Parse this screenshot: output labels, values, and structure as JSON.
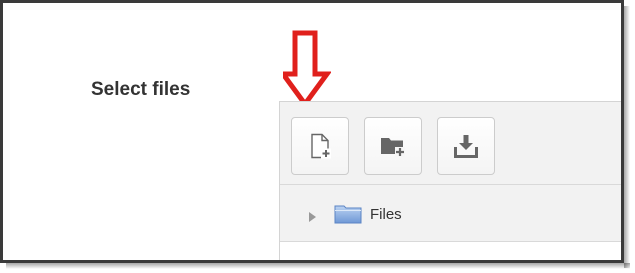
{
  "form": {
    "label": "Select files"
  },
  "annotation": {
    "arrow_color": "#e0201c",
    "icon": "down-arrow-icon"
  },
  "filemanager": {
    "toolbar": {
      "buttons": [
        {
          "icon": "add-file-icon"
        },
        {
          "icon": "create-folder-icon"
        },
        {
          "icon": "download-icon"
        }
      ]
    },
    "tree": {
      "root_label": "Files",
      "root_icon": "folder-icon"
    }
  },
  "colors": {
    "icon_gray": "#666666",
    "folder_blue": "#8fb3e3"
  }
}
